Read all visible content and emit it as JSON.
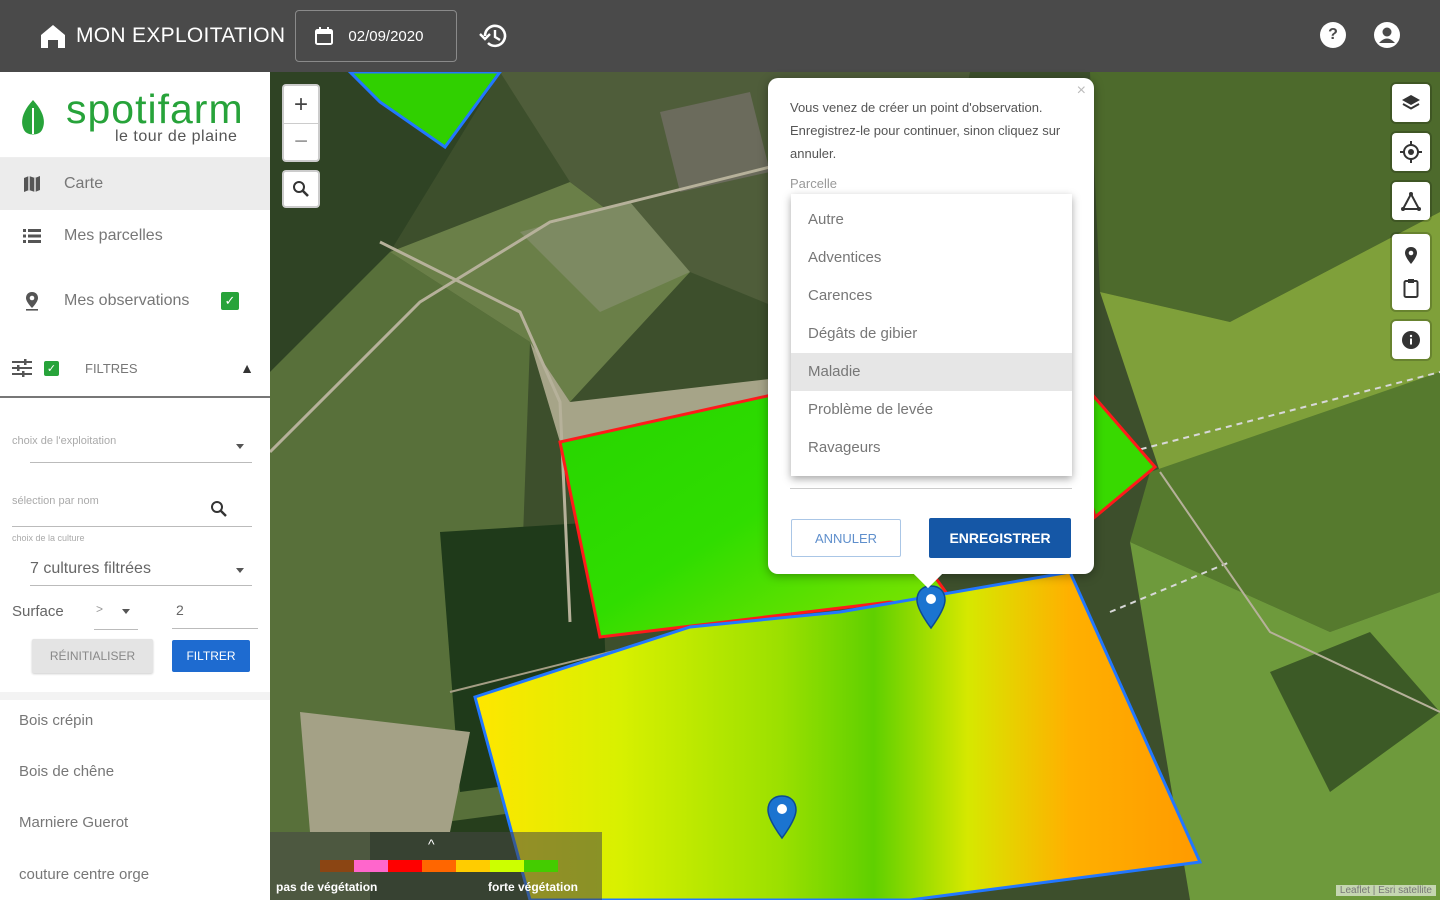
{
  "topbar": {
    "title": "MON EXPLOITATION",
    "date": "02/09/2020"
  },
  "logo": {
    "name": "spotifarm",
    "tagline": "le tour de plaine"
  },
  "nav": {
    "carte": "Carte",
    "parcelles": "Mes parcelles",
    "observations": "Mes observations"
  },
  "filters": {
    "title": "FILTRES",
    "exploitation_placeholder": "choix de l'exploitation",
    "name_placeholder": "sélection par nom",
    "culture_label": "choix de la culture",
    "culture_value": "7 cultures filtrées",
    "surface_label": "Surface",
    "surface_op": ">",
    "surface_value": "2",
    "reset": "RÉINITIALISER",
    "filter": "FILTRER"
  },
  "parcels": [
    "Bois crépin",
    "Bois de chêne",
    "Marniere Guerot",
    "couture centre orge"
  ],
  "popup": {
    "message": "Vous venez de créer un point d'observation. Enregistrez-le pour continuer, sinon cliquez sur annuler.",
    "field_label": "Parcelle",
    "options": [
      "Autre",
      "Adventices",
      "Carences",
      "Dégâts de gibier",
      "Maladie",
      "Problème de levée",
      "Ravageurs"
    ],
    "highlighted": "Maladie",
    "cancel": "ANNULER",
    "save": "ENREGISTRER"
  },
  "legend": {
    "low": "pas de végétation",
    "high": "forte végétation",
    "colors": [
      "#8b4513",
      "#ff66cc",
      "#ff0000",
      "#ff6600",
      "#ffcc00",
      "#ccff00",
      "#44cc00"
    ]
  },
  "attribution": "Leaflet | Esri satellite",
  "colors": {
    "brand_green": "#27a33a",
    "primary_blue": "#1557a6",
    "topbar": "#4a4a4a"
  }
}
